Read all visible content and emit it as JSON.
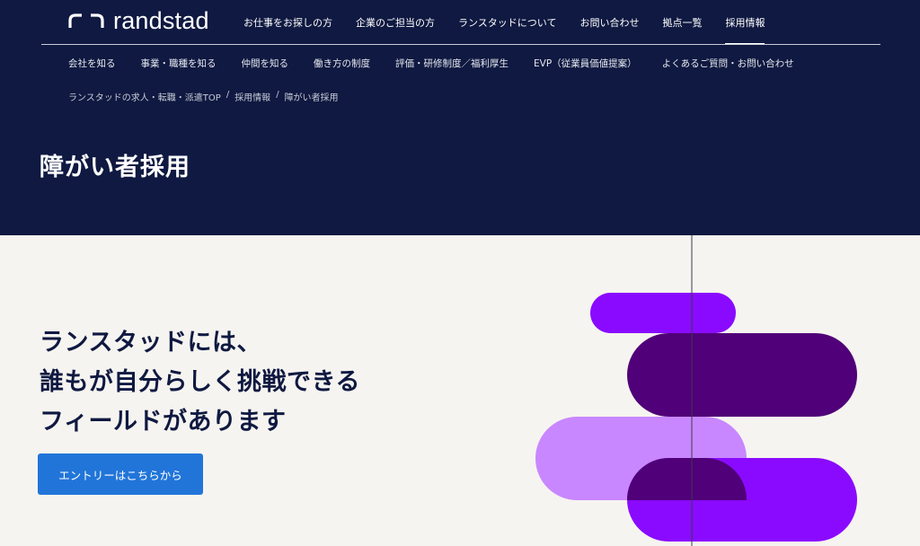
{
  "brand": {
    "name": "randstad"
  },
  "main_nav": [
    {
      "label": "お仕事をお探しの方",
      "active": false
    },
    {
      "label": "企業のご担当の方",
      "active": false
    },
    {
      "label": "ランスタッドについて",
      "active": false
    },
    {
      "label": "お問い合わせ",
      "active": false
    },
    {
      "label": "拠点一覧",
      "active": false
    },
    {
      "label": "採用情報",
      "active": true
    }
  ],
  "sub_nav": [
    {
      "label": "会社を知る"
    },
    {
      "label": "事業・職種を知る"
    },
    {
      "label": "仲間を知る"
    },
    {
      "label": "働き方の制度"
    },
    {
      "label": "評価・研修制度／福利厚生"
    },
    {
      "label": "EVP（従業員価値提案）"
    },
    {
      "label": "よくあるご質問・お問い合わせ"
    }
  ],
  "breadcrumb": [
    {
      "label": "ランスタッドの求人・転職・派遣TOP"
    },
    {
      "label": "採用情報"
    },
    {
      "label": "障がい者採用"
    }
  ],
  "breadcrumb_separator": "/",
  "page_title": "障がい者採用",
  "hero": {
    "lines": [
      "ランスタッドには、",
      "誰もが自分らしく挑戦できる",
      "フィールドがあります"
    ],
    "cta_label": "エントリーはこちらから"
  },
  "colors": {
    "navy": "#0f1941",
    "cream": "#f6f4f0",
    "cta_blue": "#2175d9",
    "violet": "#8a0aff",
    "dark_purple": "#500078",
    "lavender": "#c887ff"
  }
}
